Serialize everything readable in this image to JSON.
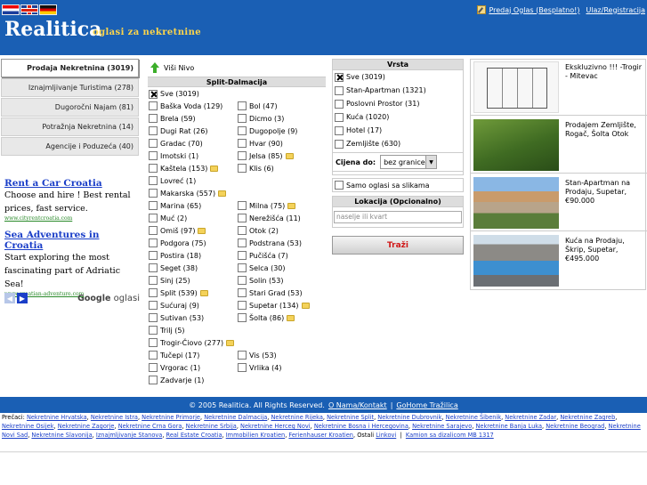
{
  "header": {
    "logo": "Realitica",
    "slogan": "oglasi za nekretnine",
    "post_ad": "Predaj Oglas (Besplatno!)",
    "login": "Ulaz/Registracija",
    "languages": [
      "hr-flag-icon",
      "en-flag-icon",
      "de-flag-icon"
    ]
  },
  "tabs": [
    {
      "label": "Prodaja Nekretnina (3019)",
      "active": true
    },
    {
      "label": "Iznajmljivanje Turistima (278)",
      "active": false
    },
    {
      "label": "Dugoročni Najam (81)",
      "active": false
    },
    {
      "label": "Potražnja Nekretnina (14)",
      "active": false
    },
    {
      "label": "Agencije i Poduzeća (40)",
      "active": false
    }
  ],
  "ads": [
    {
      "title": "Rent a Car Croatia",
      "text": "Choose and hire ! Best rental prices, fast service.",
      "url": "www.cityrentcroatia.com"
    },
    {
      "title": "Sea Adventures in Croatia",
      "text": "Start exploring the most fascinating part of Adriatic Sea!",
      "url": "www.croatian-adventure.com"
    }
  ],
  "ads_footer": {
    "google": "Google",
    "suffix": "oglasi"
  },
  "region": {
    "up_label": "Viši Nivo",
    "title": "Split-Dalmacija",
    "all": "Sve (3019)",
    "cities": [
      [
        "Baška Voda (129)",
        "Bol (47)"
      ],
      [
        "Brela (59)",
        "Dicmo (3)"
      ],
      [
        "Dugi Rat (26)",
        "Dugopolje (9)"
      ],
      [
        "Gradac (70)",
        "Hvar (90)"
      ],
      [
        "Imotski (1)",
        "Jelsa (85)"
      ],
      [
        "Kaštela (153)",
        "Klis (6)"
      ],
      [
        "Lovreć (1)",
        ""
      ],
      [
        "Makarska (557)",
        ""
      ],
      [
        "Marina (65)",
        "Milna (75)"
      ],
      [
        "Muć (2)",
        "Nerežišća (11)"
      ],
      [
        "Omiš (97)",
        "Otok (2)"
      ],
      [
        "Podgora (75)",
        "Podstrana (53)"
      ],
      [
        "Postira (18)",
        "Pučišća (7)"
      ],
      [
        "Seget (38)",
        "Selca (30)"
      ],
      [
        "Sinj (25)",
        "Solin (53)"
      ],
      [
        "Split (539)",
        "Stari Grad (53)"
      ],
      [
        "Sućuraj (9)",
        "Supetar (134)"
      ],
      [
        "Sutivan (53)",
        "Šolta (86)"
      ],
      [
        "Trilj (5)",
        ""
      ],
      [
        "Trogir-Čiovo (277)",
        ""
      ],
      [
        "Tučepi (17)",
        "Vis (53)"
      ],
      [
        "Vrgorac (1)",
        "Vrlika (4)"
      ],
      [
        "Zadvarje (1)",
        ""
      ]
    ]
  },
  "vrsta": {
    "title": "Vrsta",
    "items": [
      "Sve (3019)",
      "Stan-Apartman (1321)",
      "Poslovni Prostor (31)",
      "Kuća (1020)",
      "Hotel (17)",
      "Zemljište (630)"
    ]
  },
  "price": {
    "label": "Cijena do:",
    "value": "bez granice"
  },
  "photos_only": "Samo oglasi sa slikama",
  "location": {
    "title": "Lokacija (Opcionalno)",
    "placeholder": "naselje ili kvart"
  },
  "search_button": "Traži",
  "listings": [
    {
      "text": "Ekskluzivno !!! -Trogir - Mitevac",
      "thumb": "floor-plan"
    },
    {
      "text": "Prodajem Zemljište, Rogač, Šolta Otok",
      "thumb": "green-land"
    },
    {
      "text": "Stan-Apartman na Prodaju, Supetar, €90.000",
      "thumb": "town-view"
    },
    {
      "text": "Kuća na Prodaju, Škrip, Supetar, €495.000",
      "thumb": "sea-pool"
    }
  ],
  "footer": {
    "copyright": "© 2005 Realitica. All Rights Reserved.",
    "about": "O Nama/Kontakt",
    "separator": "|",
    "gohome": "GoHome Tražilica"
  },
  "shortcuts": {
    "label": "Prečaci:",
    "links": [
      "Nekretnine Hrvatska",
      "Nekretnine Istra",
      "Nekretnine Primorje",
      "Nekretnine Dalmacija",
      "Nekretnine Rijeka",
      "Nekretnine Split",
      "Nekretnine Dubrovnik",
      "Nekretnine Šibenik",
      "Nekretnine Zadar",
      "Nekretnine Zagreb",
      "Nekretnine Osijek",
      "Nekretnine Zagorje",
      "Nekretnine Crna Gora",
      "Nekretnine Srbija",
      "Nekretnine Herceg Novi",
      "Nekretnine Bosna i Hercegovina",
      "Nekretnine Sarajevo",
      "Nekretnine Banja Luka",
      "Nekretnine Beograd",
      "Nekretnine Novi Sad",
      "Nekretnine Slavonija",
      "Iznajmljivanje Stanova",
      "Real Estate Croatia",
      "Immobilien Kroatien",
      "Ferienhauser Kroatien"
    ],
    "others_label": "Ostali",
    "others_link": "Linkovi",
    "sep": "|",
    "extra_link": "Kamion sa dizalicom MB 1317"
  }
}
